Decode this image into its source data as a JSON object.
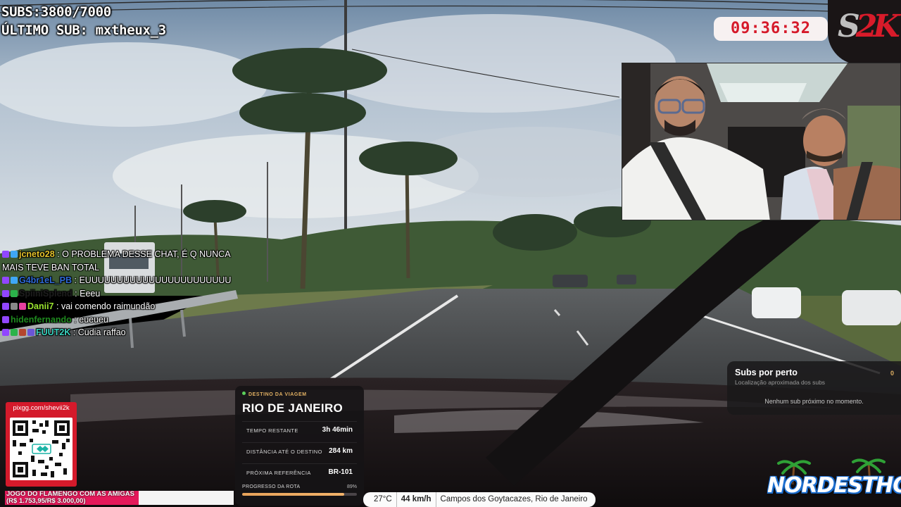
{
  "overlay": {
    "subs_line": "SUBS:3800/7000",
    "last_sub_line": "ÚLTIMO SUB: mxtheux_3",
    "clock": "09:36:32",
    "brand_logo": "S2K"
  },
  "chat": {
    "messages": [
      {
        "user": "jcneto28",
        "user_color": "#e3c22a",
        "badge_colors": [
          "#9146ff",
          "#3fa7f5"
        ],
        "text": " O PROBLEMA DESSE CHAT, É Q NUNCA MAIS TEVE BAN TOTAL"
      },
      {
        "user": "G4br1eL_PB",
        "user_color": "#2f6bd8",
        "badge_colors": [
          "#9146ff",
          "#3fa7f5"
        ],
        "text": " EUUUUUUUUUUUUUUUUUUUUUUU"
      },
      {
        "user": "SpiiniSplend",
        "user_color": "#1e1e1e",
        "badge_colors": [
          "#9146ff",
          "#2bb34a"
        ],
        "text": " Eeeu"
      },
      {
        "user": "Danii7",
        "user_color": "#9be52f",
        "badge_colors": [
          "#9146ff",
          "#888888",
          "#e63fa0"
        ],
        "text": " vai comendo raimundão"
      },
      {
        "user": "hidenfernando",
        "user_color": "#1e8a1e",
        "badge_colors": [
          "#9146ff"
        ],
        "text": " eueueu"
      },
      {
        "user": "FUUT2K",
        "user_color": "#3ad3c0",
        "badge_colors": [
          "#9146ff",
          "#2bb34a",
          "#b4452e",
          "#6a55d6"
        ],
        "text": " Cudia raffao"
      }
    ]
  },
  "qr": {
    "url": "pixgg.com/shevii2k"
  },
  "goal": {
    "label": "JOGO DO FLAMENGO COM AS AMIGAS",
    "amount": "(R$ 1.753,95/R$ 3.000,00)",
    "progress": 0.585
  },
  "destination": {
    "kicker": "DESTINO DA VIAGEM",
    "city": "RIO DE JANEIRO",
    "rows": [
      {
        "label": "TEMPO RESTANTE",
        "value": "3h 46min"
      },
      {
        "label": "DISTÂNCIA ATÉ O DESTINO",
        "value": "284 km"
      },
      {
        "label": "PRÓXIMA REFERÊNCIA",
        "value": "BR-101"
      }
    ],
    "progress_label": "PROGRESSO DA ROTA",
    "progress_pct_label": "89%",
    "progress": 0.89
  },
  "nearby": {
    "title": "Subs por perto",
    "count": "0",
    "subtitle": "Localização aproximada dos subs",
    "empty": "Nenhum sub próximo no momento."
  },
  "status": {
    "temperature": "27°C",
    "speed": "44 km/h",
    "location": "Campos dos Goytacazes, Rio de Janeiro"
  },
  "footer_logo": {
    "text": "NORDESTHON"
  },
  "colors": {
    "brand_red": "#d61a2a",
    "goal_pink": "#e4195a",
    "accent_gold": "#e0b063"
  }
}
